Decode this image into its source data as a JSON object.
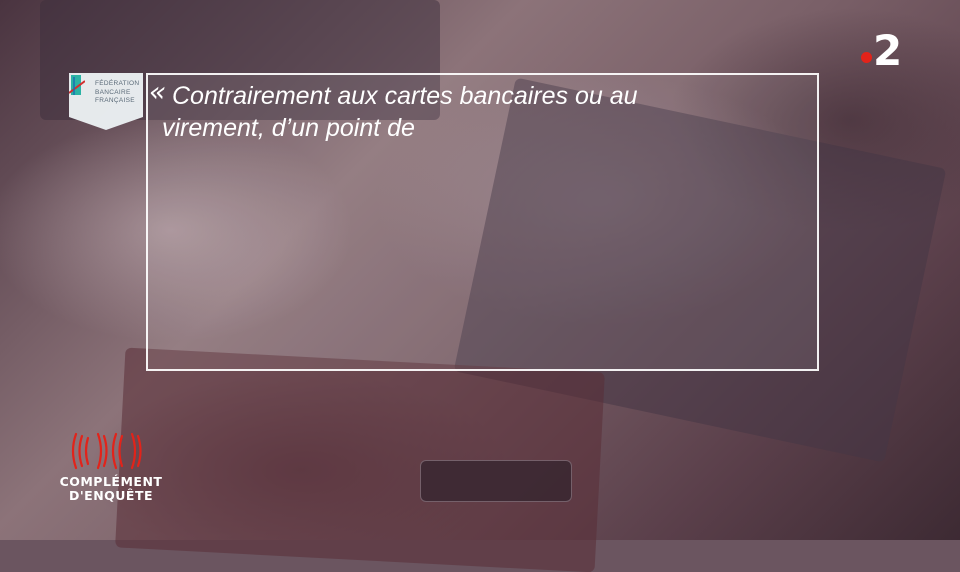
{
  "quote": {
    "open_mark": "«",
    "line1": "Contrairement aux cartes bancaires ou au",
    "line2": "virement, d’un point de"
  },
  "source_badge": {
    "line1": "FÉDÉRATION",
    "line2": "BANCAIRE",
    "line3": "FRANÇAISE"
  },
  "channel": {
    "number": "2",
    "dot_color": "#e2231a"
  },
  "show": {
    "line1": "COMPLÉMENT",
    "line2": "D'ENQUÊTE",
    "accent_color": "#e2231a"
  }
}
